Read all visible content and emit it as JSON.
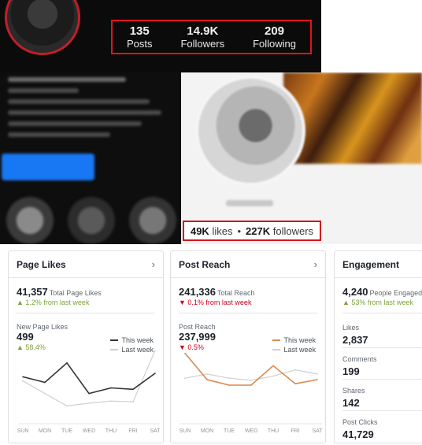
{
  "instagram": {
    "stats": [
      {
        "value": "135",
        "label": "Posts"
      },
      {
        "value": "14.9K",
        "label": "Followers"
      },
      {
        "value": "209",
        "label": "Following"
      }
    ],
    "highlight_color": "#e0141e"
  },
  "facebook_page": {
    "likes_value": "49K",
    "likes_label": "likes",
    "separator": "•",
    "followers_value": "227K",
    "followers_label": "followers"
  },
  "insights": {
    "page_likes": {
      "title": "Page Likes",
      "total": "41,357",
      "total_label": "Total Page Likes",
      "change": "▲ 1.2% from last week",
      "section_label": "New Page Likes",
      "section_value": "499",
      "section_change": "▲ 58.4%",
      "legend_this": "This week",
      "legend_last": "Last week",
      "days": [
        "SUN",
        "MON",
        "TUE",
        "WED",
        "THU",
        "FRI",
        "SAT"
      ],
      "this_color": "#333333",
      "last_color": "#cfcfcf"
    },
    "post_reach": {
      "title": "Post Reach",
      "total": "241,336",
      "total_label": "Total Reach",
      "change": "▼ 0.1% from last week",
      "section_label": "Post Reach",
      "section_value": "237,999",
      "section_change": "▼ 0.5%",
      "legend_this": "This week",
      "legend_last": "Last week",
      "days": [
        "SUN",
        "MON",
        "TUE",
        "WED",
        "THU",
        "FRI",
        "SAT"
      ],
      "this_color": "#d9894e",
      "last_color": "#cfcfcf"
    },
    "engagement": {
      "title": "Engagement",
      "total": "4,240",
      "total_label": "People Engaged",
      "change": "▲ 53% from last week",
      "items": [
        {
          "label": "Likes",
          "value": "2,837"
        },
        {
          "label": "Comments",
          "value": "199"
        },
        {
          "label": "Shares",
          "value": "142"
        },
        {
          "label": "Post Clicks",
          "value": "41,729"
        }
      ]
    }
  },
  "chart_data": [
    {
      "type": "line",
      "title": "New Page Likes",
      "categories": [
        "SUN",
        "MON",
        "TUE",
        "WED",
        "THU",
        "FRI",
        "SAT"
      ],
      "series": [
        {
          "name": "This week",
          "values": [
            62,
            54,
            82,
            38,
            46,
            44,
            67
          ]
        },
        {
          "name": "Last week",
          "values": [
            56,
            38,
            20,
            24,
            27,
            26,
            100
          ]
        }
      ],
      "ylim": [
        0,
        100
      ]
    },
    {
      "type": "line",
      "title": "Post Reach",
      "categories": [
        "SUN",
        "MON",
        "TUE",
        "WED",
        "THU",
        "FRI",
        "SAT"
      ],
      "series": [
        {
          "name": "This week",
          "values": [
            96,
            58,
            50,
            50,
            78,
            52,
            58
          ]
        },
        {
          "name": "Last week",
          "values": [
            60,
            66,
            60,
            57,
            63,
            72,
            66
          ]
        }
      ],
      "ylim": [
        0,
        100
      ]
    }
  ]
}
